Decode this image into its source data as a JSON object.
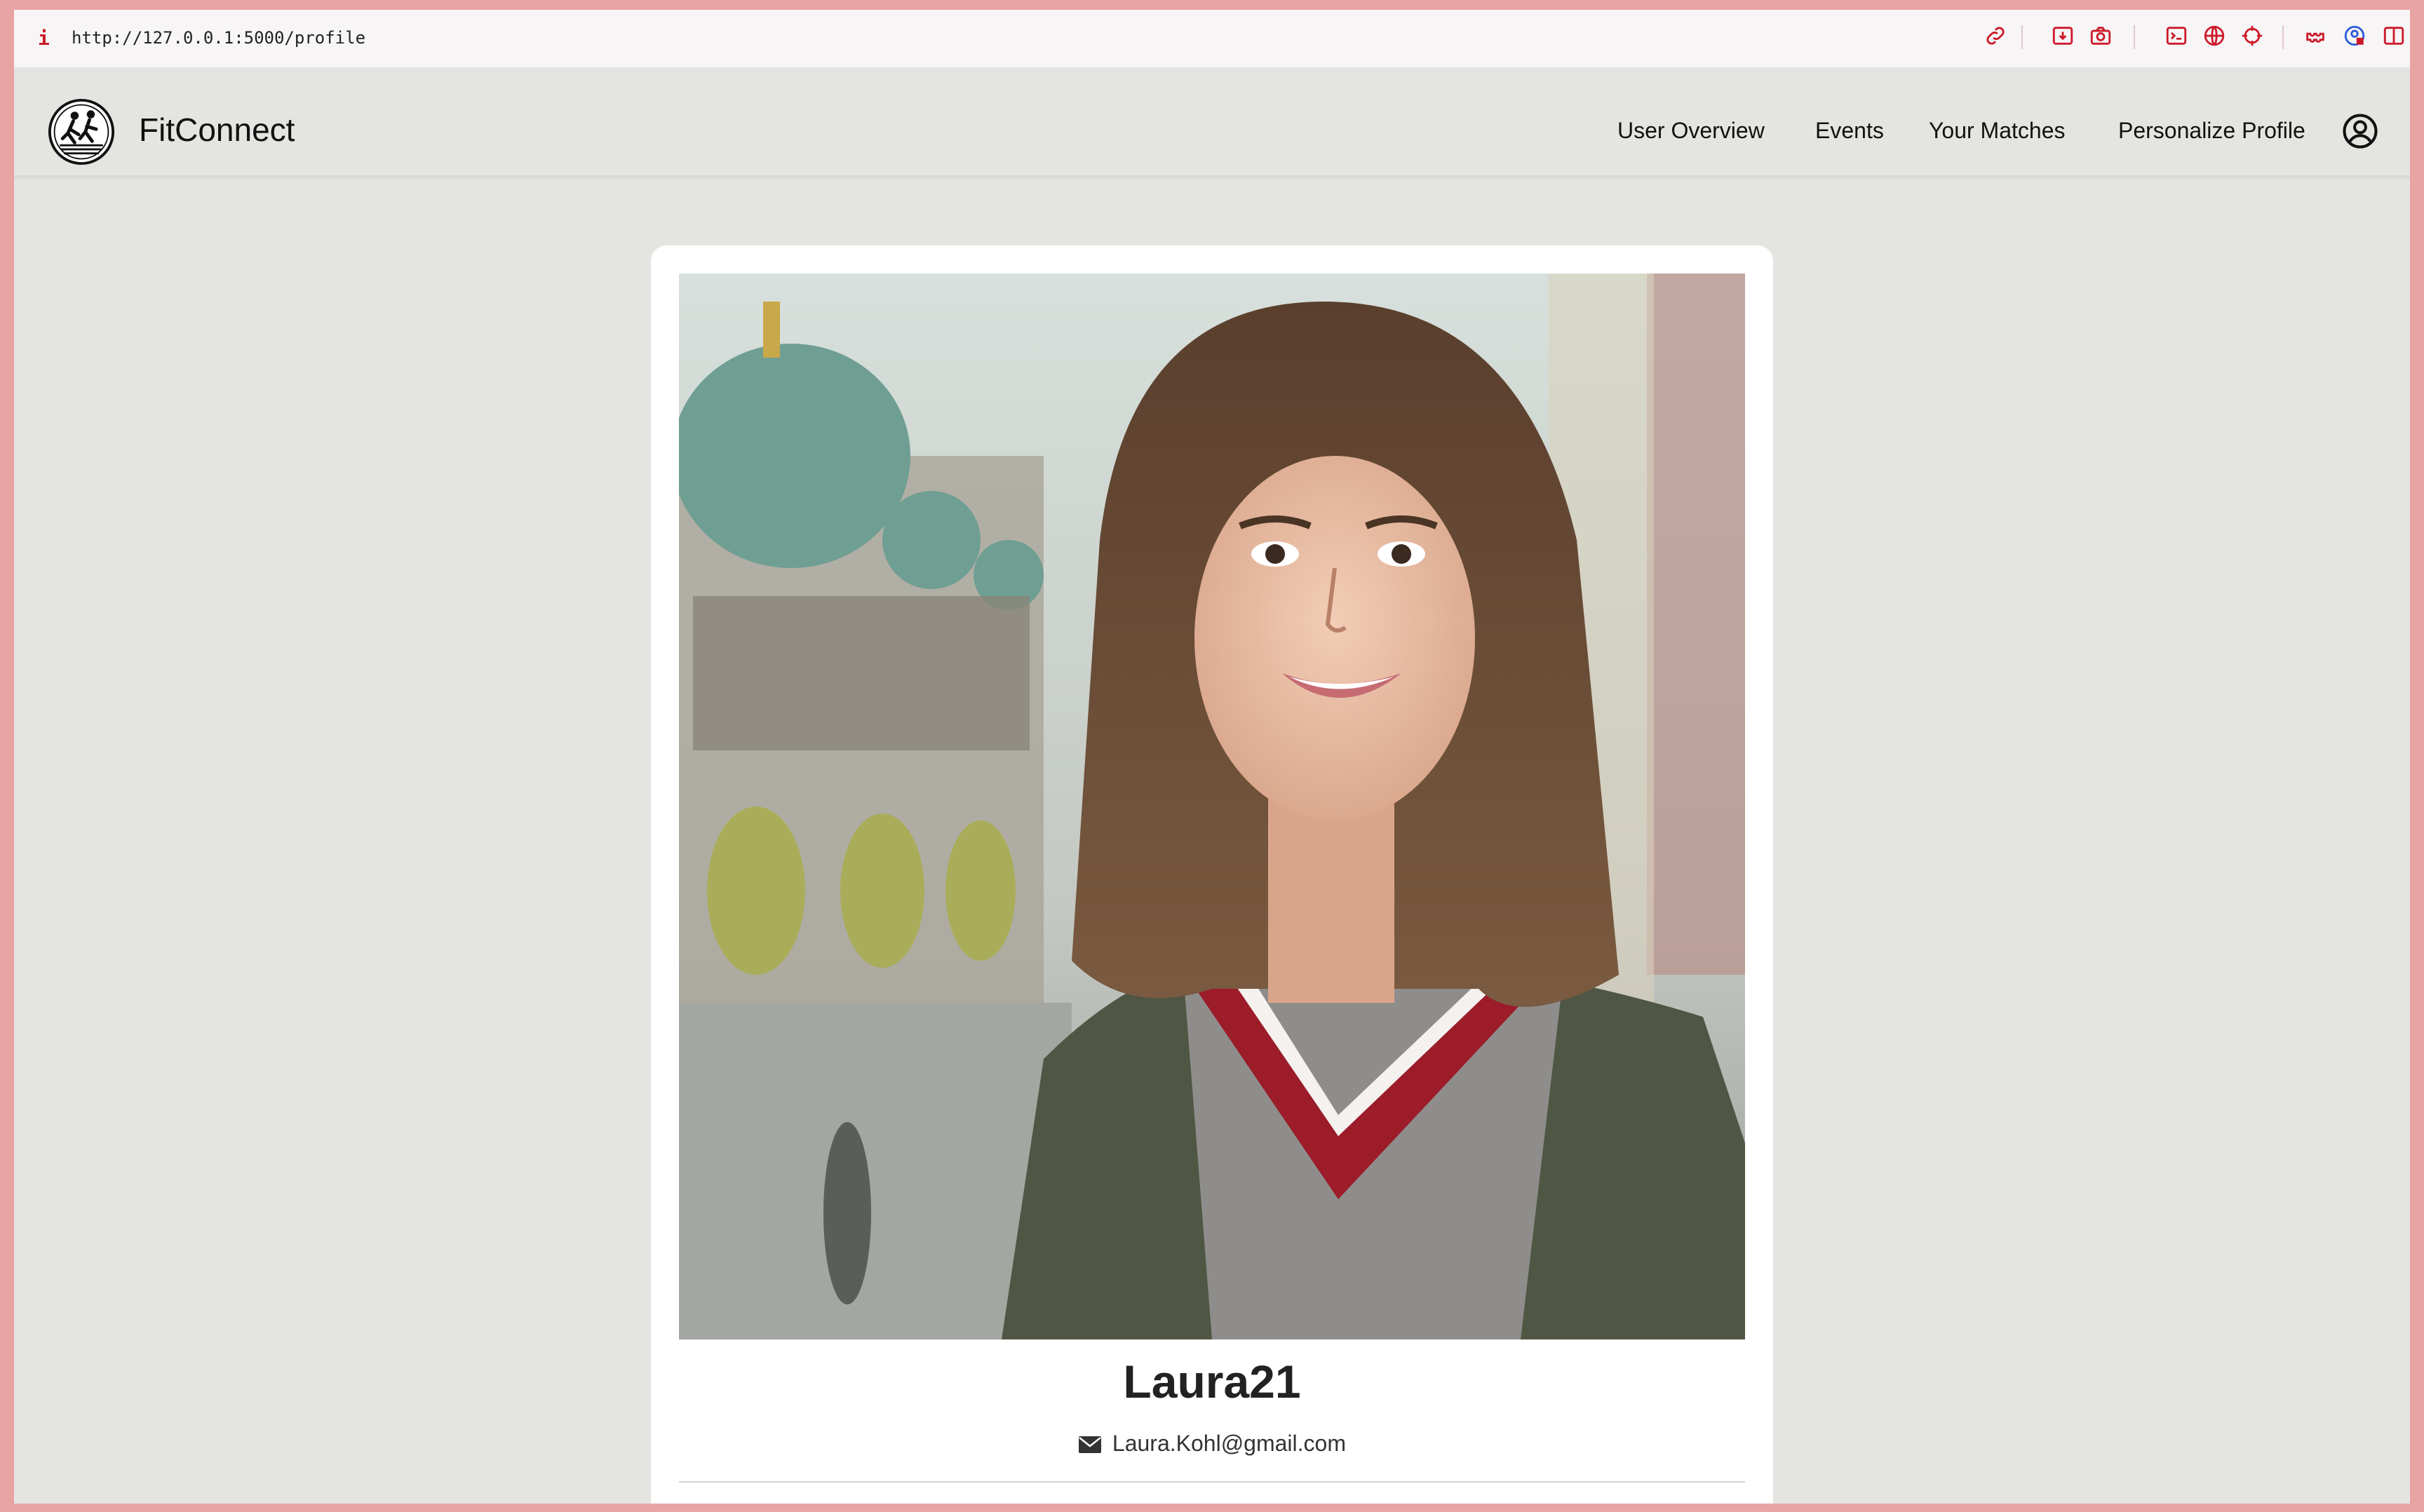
{
  "browser": {
    "info_glyph": "i",
    "url": "http://127.0.0.1:5000/profile"
  },
  "header": {
    "brand": "FitConnect",
    "nav": [
      "User Overview",
      "Events",
      "Your Matches",
      "Personalize Profile"
    ]
  },
  "profile": {
    "username": "Laura21",
    "email": "Laura.Kohl@gmail.com"
  },
  "colors": {
    "window_frame": "#e8a3a3",
    "page_bg": "#e4e5e1",
    "card_bg": "#ffffff",
    "toolbar_icon": "#cc1a2a"
  },
  "icons": [
    "link-icon",
    "download-icon",
    "camera-icon",
    "terminal-icon",
    "globe-icon",
    "crosshair-icon",
    "extension-icon",
    "account-icon",
    "sidebar-icon",
    "user-circle-icon",
    "envelope-icon"
  ]
}
